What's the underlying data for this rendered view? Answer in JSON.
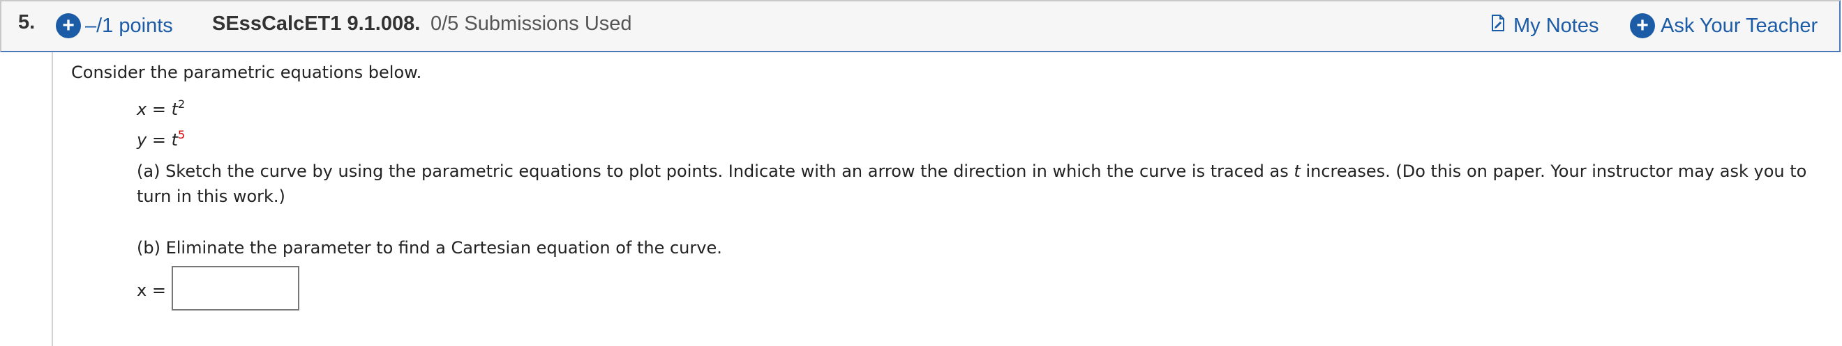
{
  "question": {
    "number": "5.",
    "points": "–/1 points",
    "code": "SEssCalcET1 9.1.008.",
    "submissions": "0/5 Submissions Used",
    "my_notes": "My Notes",
    "ask_teacher": "Ask Your Teacher"
  },
  "body": {
    "intro": "Consider the parametric equations below.",
    "eq1": {
      "lhs": "x",
      "equals": "=",
      "var": "t",
      "exp": "2"
    },
    "eq2": {
      "lhs": "y",
      "equals": "=",
      "var": "t",
      "exp": "5"
    },
    "part_a": {
      "prefix": "(a) Sketch the curve by using the parametric equations to plot points. Indicate with an arrow the direction in which the curve is traced as ",
      "var": "t",
      "suffix": " increases. (Do this on paper. Your instructor may ask you to turn in this work.)"
    },
    "part_b": "(b) Eliminate the parameter to find a Cartesian equation of the curve.",
    "answer": {
      "label": "x =",
      "value": ""
    }
  },
  "colors": {
    "link": "#1c5ba6",
    "highlight_red": "#d40000",
    "header_bg": "#f6f6f6"
  },
  "icons": [
    "plus-circle-icon",
    "note-icon"
  ]
}
